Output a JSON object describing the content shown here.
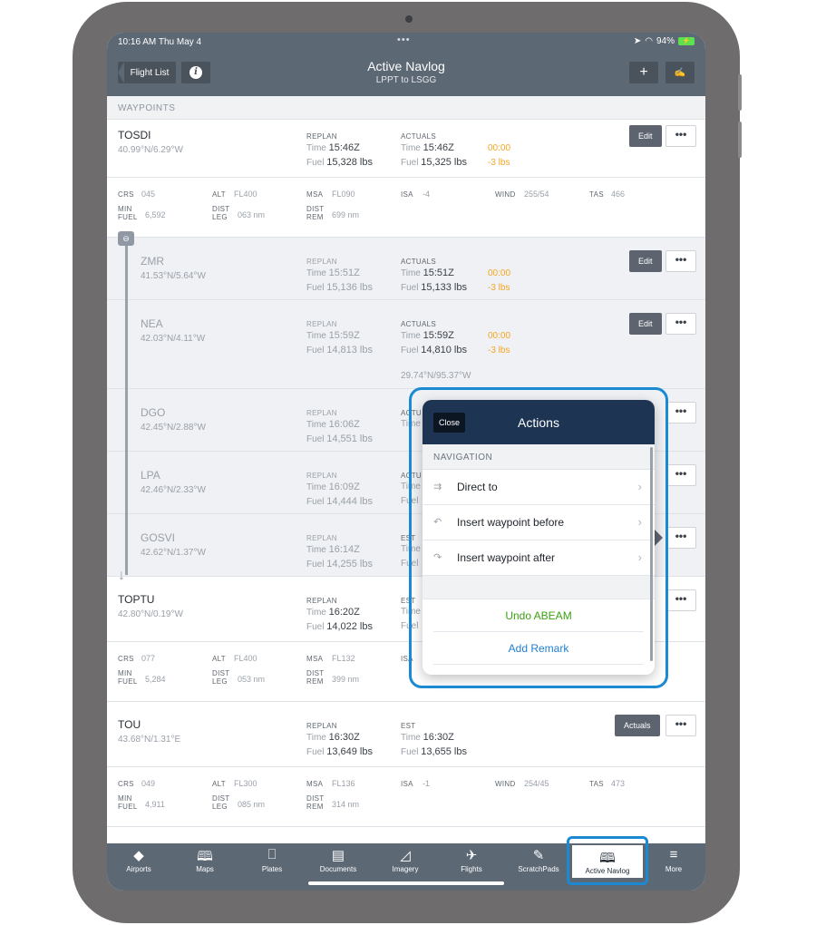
{
  "status": {
    "time": "10:16 AM  Thu May 4",
    "dots": "•••",
    "battery": "94%"
  },
  "nav": {
    "back_label": "Flight List",
    "info_label": "i",
    "title": "Active Navlog",
    "subtitle": "LPPT to LSGG",
    "add_label": "+",
    "sign_label": "✍"
  },
  "section_label": "WAYPOINTS",
  "labels": {
    "replan": "REPLAN",
    "actuals": "ACTUALS",
    "est": "EST",
    "time": "Time",
    "fuel": "Fuel",
    "crs": "CRS",
    "alt": "ALT",
    "msa": "MSA",
    "isa": "ISA",
    "wind": "WIND",
    "tas": "TAS",
    "min": "MIN",
    "fuel_cap": "FUEL",
    "dist": "DIST",
    "leg": "LEG",
    "rem": "REM",
    "edit": "Edit",
    "actuals_btn": "Actuals",
    "more": "•••"
  },
  "waypoints": [
    {
      "name": "TOSDI",
      "coord": "40.99°N/6.29°W",
      "replan_time": "15:46Z",
      "replan_fuel": "15,328 lbs",
      "act_time": "15:46Z",
      "act_fuel": "15,325 lbs",
      "delta_time": "00:00",
      "delta_fuel": "-3 lbs",
      "crs": "045",
      "alt": "FL400",
      "msa": "FL090",
      "isa": "-4",
      "wind": "255/54",
      "tas": "466",
      "min_fuel": "6,592",
      "dist_leg": "063 nm",
      "dist_rem": "699 nm"
    },
    {
      "name": "ZMR",
      "coord": "41.53°N/5.64°W",
      "replan_time": "15:51Z",
      "replan_fuel": "15,136 lbs",
      "act_time": "15:51Z",
      "act_fuel": "15,133 lbs",
      "delta_time": "00:00",
      "delta_fuel": "-3 lbs"
    },
    {
      "name": "NEA",
      "coord": "42.03°N/4.11°W",
      "replan_time": "15:59Z",
      "replan_fuel": "14,813 lbs",
      "act_time": "15:59Z",
      "act_fuel": "14,810 lbs",
      "delta_time": "00:00",
      "delta_fuel": "-3 lbs",
      "extra_coord": "29.74°N/95.37°W"
    },
    {
      "name": "DGO",
      "coord": "42.45°N/2.88°W",
      "replan_time": "16:06Z",
      "replan_fuel": "14,551 lbs",
      "act_label": "ACTU",
      "act_time_label": "Time"
    },
    {
      "name": "LPA",
      "coord": "42.46°N/2.33°W",
      "replan_time": "16:09Z",
      "replan_fuel": "14,444 lbs",
      "act_label": "ACTU",
      "act_time_label": "Time",
      "act_fuel_label": "Fuel"
    },
    {
      "name": "GOSVI",
      "coord": "42.62°N/1.37°W",
      "replan_time": "16:14Z",
      "replan_fuel": "14,255 lbs",
      "act_label": "EST",
      "act_time_label": "Time",
      "act_fuel_label": "Fuel"
    },
    {
      "name": "TOPTU",
      "coord": "42.80°N/0.19°W",
      "replan_time": "16:20Z",
      "replan_fuel": "14,022 lbs",
      "act_label": "EST",
      "act_time_label": "Time",
      "act_fuel_label": "Fuel",
      "crs": "077",
      "alt": "FL400",
      "msa": "FL132",
      "isa_label": "ISA",
      "min_fuel": "5,284",
      "dist_leg": "053 nm",
      "dist_rem": "399 nm"
    },
    {
      "name": "TOU",
      "coord": "43.68°N/1.31°E",
      "replan_time": "16:30Z",
      "replan_fuel": "13,649 lbs",
      "est_time": "16:30Z",
      "est_fuel": "13,655 lbs",
      "crs": "049",
      "alt": "FL300",
      "msa": "FL136",
      "isa": "-1",
      "wind": "254/45",
      "tas": "473",
      "min_fuel": "4,911",
      "dist_leg": "085 nm",
      "dist_rem": "314 nm"
    }
  ],
  "popover": {
    "close_label": "Close",
    "title": "Actions",
    "section": "NAVIGATION",
    "items": [
      {
        "icon": "⇉",
        "label": "Direct to",
        "chevron": "›"
      },
      {
        "icon": "↶",
        "label": "Insert waypoint before",
        "chevron": "›"
      },
      {
        "icon": "↷",
        "label": "Insert waypoint after",
        "chevron": "›"
      }
    ],
    "actions": [
      {
        "label": "Undo ABEAM",
        "color": "#3aa112"
      },
      {
        "label": "Add Remark",
        "color": "#1f7fd1"
      }
    ]
  },
  "tabs": [
    {
      "icon": "◆",
      "label": "Airports"
    },
    {
      "icon": "🕮",
      "label": "Maps"
    },
    {
      "icon": "⎕",
      "label": "Plates"
    },
    {
      "icon": "▤",
      "label": "Documents"
    },
    {
      "icon": "◿",
      "label": "Imagery"
    },
    {
      "icon": "✈",
      "label": "Flights"
    },
    {
      "icon": "✎",
      "label": "ScratchPads"
    },
    {
      "icon": "🕮",
      "label": "Active Navlog"
    },
    {
      "icon": "≡",
      "label": "More"
    }
  ],
  "colors": {
    "nav_bg": "#5d6875",
    "popover_head": "#1d3553",
    "highlight": "#1b8ad3",
    "delta": "#f5a623"
  }
}
